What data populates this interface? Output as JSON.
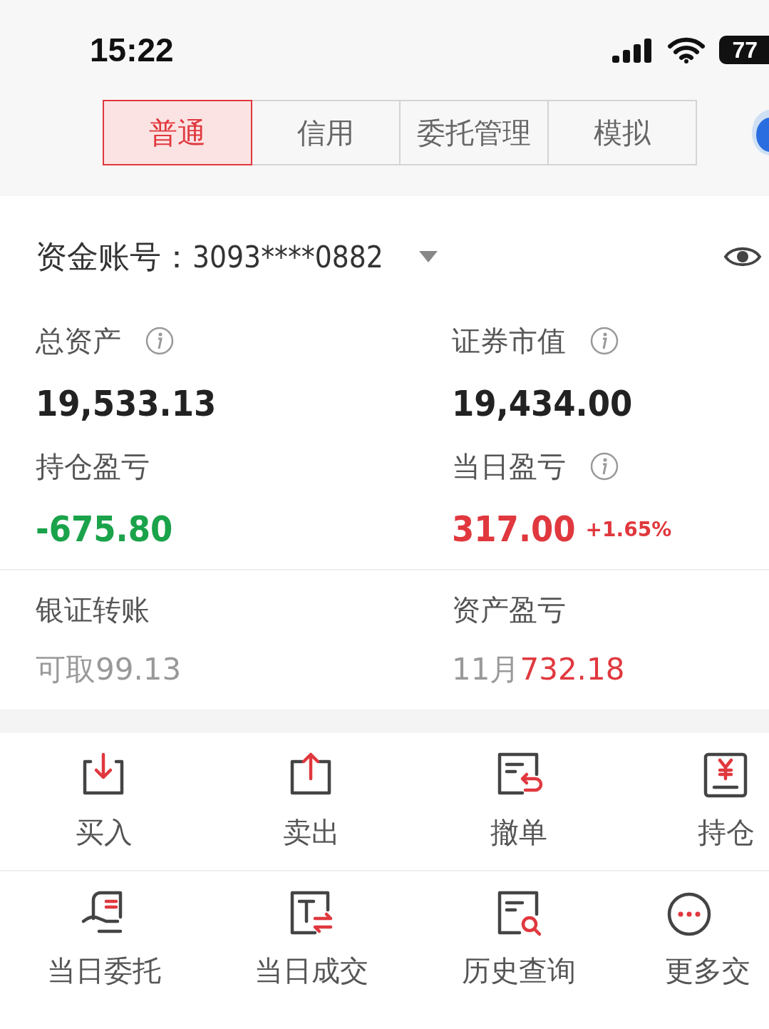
{
  "status_bar": {
    "time": "15:22",
    "battery": "77"
  },
  "tabs": [
    {
      "label": "普通",
      "selected": true
    },
    {
      "label": "信用",
      "selected": false
    },
    {
      "label": "委托管理",
      "selected": false
    },
    {
      "label": "模拟",
      "selected": false
    }
  ],
  "account": {
    "label": "资金账号：",
    "number": "3093****0882"
  },
  "metrics": [
    {
      "label": "总资产",
      "info": true,
      "value": "19,533.13",
      "kind": "plain"
    },
    {
      "label": "证券市值",
      "info": true,
      "value": "19,434.00",
      "kind": "plain"
    },
    {
      "label": "持仓盈亏",
      "info": false,
      "value": "-675.80",
      "kind": "loss"
    },
    {
      "label": "当日盈亏",
      "info": true,
      "value": "317.00",
      "change": "+1.65%",
      "kind": "gain"
    }
  ],
  "summary": [
    {
      "label": "银证转账",
      "prefix": "可取",
      "value": "99.13",
      "kind": "plain"
    },
    {
      "label": "资产盈亏",
      "prefix": "11月",
      "value": "732.18",
      "kind": "gain"
    }
  ],
  "actions": [
    {
      "label": "买入"
    },
    {
      "label": "卖出"
    },
    {
      "label": "撤单"
    },
    {
      "label": "持仓"
    },
    {
      "label": "当日委托"
    },
    {
      "label": "当日成交"
    },
    {
      "label": "历史查询"
    },
    {
      "label": "更多交"
    }
  ]
}
